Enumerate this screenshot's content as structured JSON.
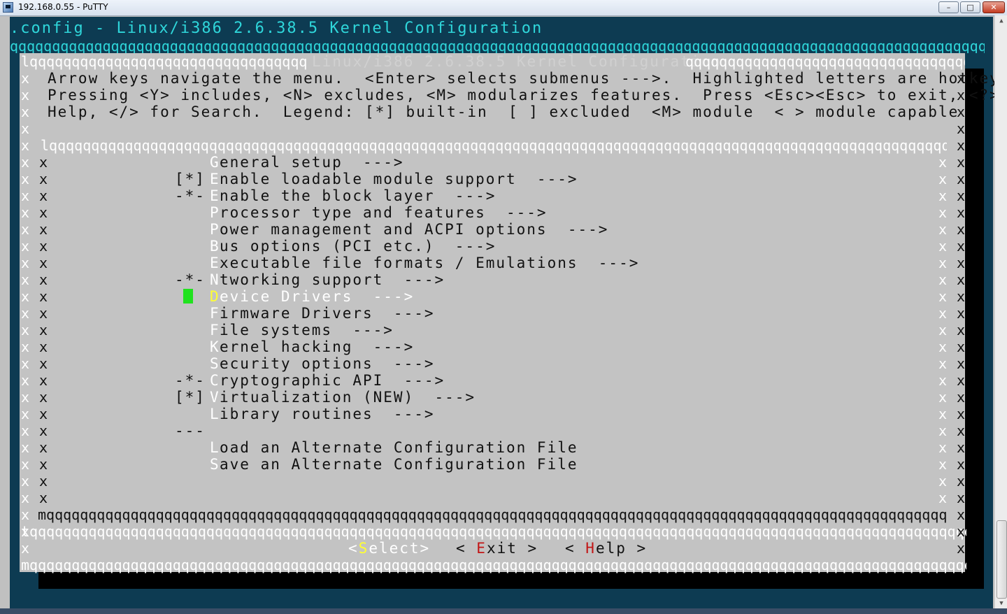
{
  "window": {
    "title": "192.168.0.55 - PuTTY",
    "buttons": {
      "minimize": "–",
      "maximize": "□",
      "close": "✕"
    }
  },
  "terminal": {
    "config_title": ".config - Linux/i386 2.6.38.5 Kernel Configuration",
    "dialog_title_ghost": "Linux/i386 2.6.38.5 Kernel Configuration",
    "help_lines": [
      "Arrow keys navigate the menu.  <Enter> selects submenus --->.  Highlighted letters are hotkeys.",
      "Pressing <Y> includes, <N> excludes, <M> modularizes features.  Press <Esc><Esc> to exit, <?> for",
      "Help, </> for Search.  Legend: [*] built-in  [ ] excluded  <M> module  < > module capable"
    ],
    "menu": [
      {
        "marker": "",
        "hotkey": "G",
        "label": "eneral setup  --->"
      },
      {
        "marker": "[*]",
        "hotkey": "E",
        "label": "nable loadable module support  --->"
      },
      {
        "marker": "-*-",
        "hotkey": "E",
        "label": "nable the block layer  --->"
      },
      {
        "marker": "",
        "hotkey": "P",
        "label": "rocessor type and features  --->"
      },
      {
        "marker": "",
        "hotkey": "P",
        "label": "ower management and ACPI options  --->"
      },
      {
        "marker": "",
        "hotkey": "B",
        "label": "us options (PCI etc.)  --->"
      },
      {
        "marker": "",
        "hotkey": "E",
        "label": "xecutable file formats / Emulations  --->"
      },
      {
        "marker": "-*-",
        "hotkey": "N",
        "label": "tworking support  --->"
      },
      {
        "marker": "",
        "hotkey": "D",
        "label": "evice Drivers  --->",
        "selected": true
      },
      {
        "marker": "",
        "hotkey": "F",
        "label": "irmware Drivers  --->"
      },
      {
        "marker": "",
        "hotkey": "F",
        "label": "ile systems  --->"
      },
      {
        "marker": "",
        "hotkey": "K",
        "label": "ernel hacking  --->"
      },
      {
        "marker": "",
        "hotkey": "S",
        "label": "ecurity options  --->"
      },
      {
        "marker": "-*-",
        "hotkey": "C",
        "label": "ryptographic API  --->"
      },
      {
        "marker": "[*]",
        "hotkey": "V",
        "label": "irtualization (NEW)  --->"
      },
      {
        "marker": "",
        "hotkey": "L",
        "label": "ibrary routines  --->"
      },
      {
        "marker": "---",
        "hotkey": "",
        "label": ""
      },
      {
        "marker": "",
        "hotkey": "L",
        "label": "oad an Alternate Configuration File"
      },
      {
        "marker": "",
        "hotkey": "S",
        "label": "ave an Alternate Configuration File"
      }
    ],
    "selected_item_text": "Device Drivers  --->",
    "buttons": {
      "select_open": "<",
      "select_hot": "S",
      "select_rest": "elect>",
      "exit_open": "< ",
      "exit_hot": "E",
      "exit_rest": "xit >",
      "help_open": "< ",
      "help_hot": "H",
      "help_rest": "elp >"
    }
  },
  "colors": {
    "terminal_bg": "#0d3b52",
    "dialog_bg": "#c3c3c3",
    "title_cyan": "#2fd6da",
    "cursor_green": "#21e21f",
    "hotkey_red": "#c21616",
    "hotkey_yellow": "#ffff33"
  }
}
